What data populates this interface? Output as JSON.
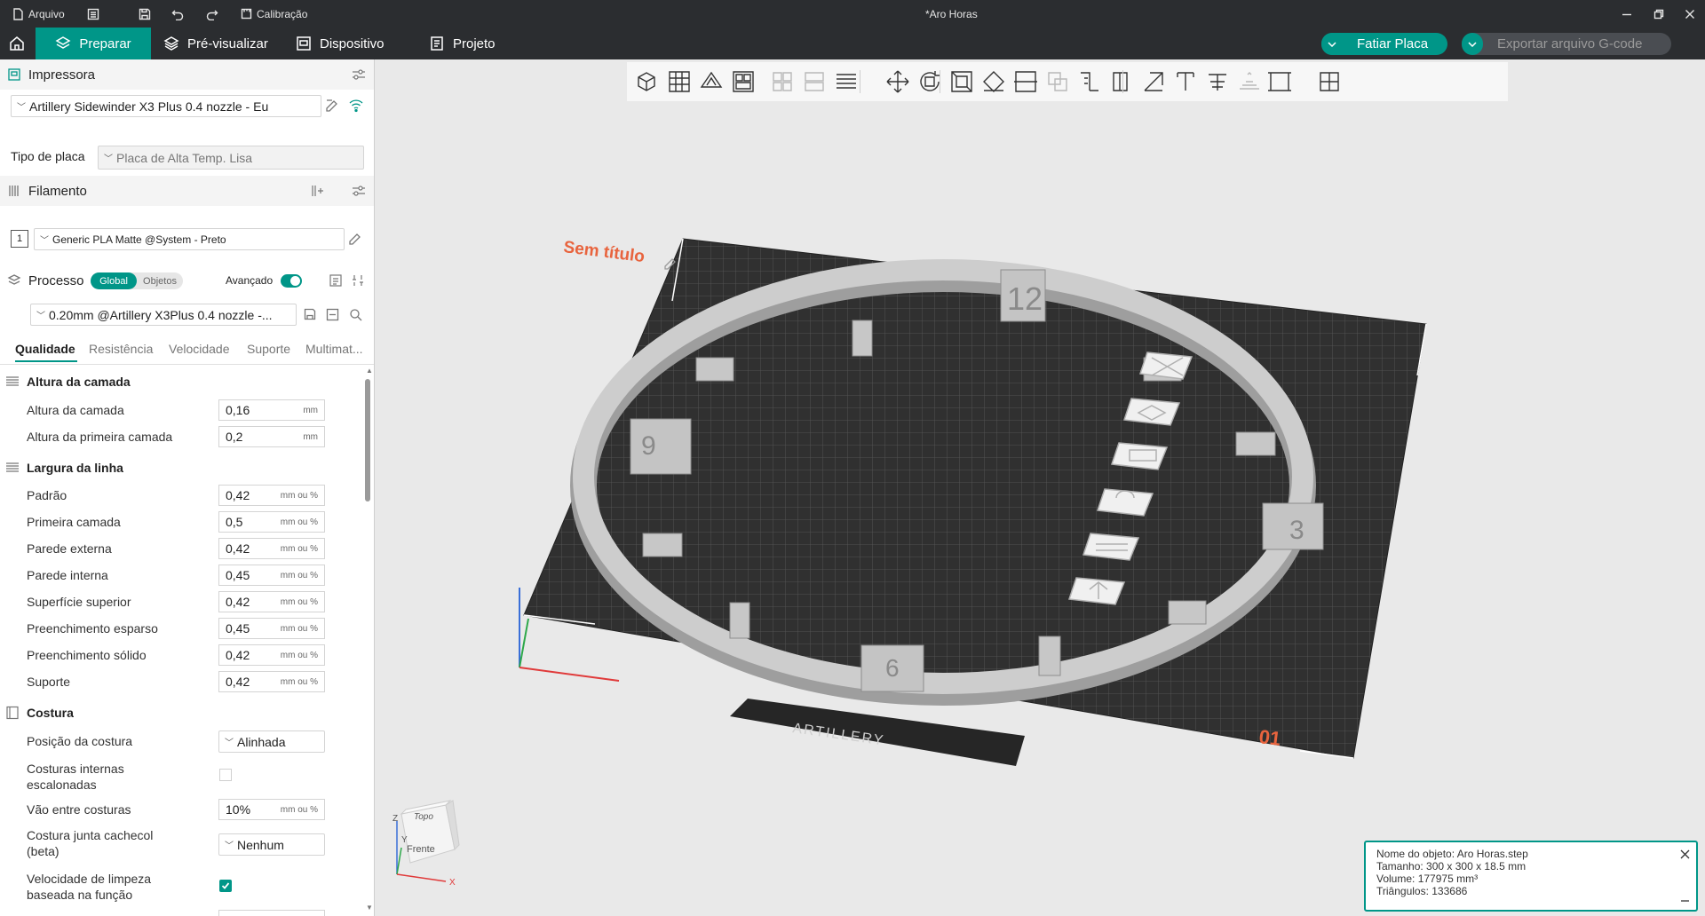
{
  "titlebar": {
    "file_label": "Arquivo",
    "calibration_label": "Calibração",
    "window_title": "*Aro Horas"
  },
  "menubar": {
    "tabs": [
      {
        "label": "Preparar",
        "active": true
      },
      {
        "label": "Pré-visualizar",
        "active": false
      },
      {
        "label": "Dispositivo",
        "active": false
      },
      {
        "label": "Projeto",
        "active": false
      }
    ],
    "slice_label": "Fatiar Placa",
    "export_label": "Exportar arquivo G-code",
    "accent_color": "#009688"
  },
  "printer": {
    "section_title": "Impressora",
    "selected_printer": "Artillery Sidewinder X3 Plus 0.4 nozzle - Eu",
    "plate_type_label": "Tipo de placa",
    "plate_type_value": "Placa de Alta Temp. Lisa"
  },
  "filament": {
    "section_title": "Filamento",
    "slot_number": "1",
    "selected_filament": "Generic PLA Matte @System - Preto"
  },
  "process": {
    "section_title": "Processo",
    "scope_global": "Global",
    "scope_objects": "Objetos",
    "advanced_label": "Avançado",
    "advanced_on": true,
    "profile": "0.20mm @Artillery X3Plus 0.4 nozzle -...",
    "tabs": [
      "Qualidade",
      "Resistência",
      "Velocidade",
      "Suporte",
      "Multimat..."
    ]
  },
  "settings": {
    "layer_height": {
      "title": "Altura da camada",
      "rows": [
        {
          "label": "Altura da camada",
          "value": "0,16",
          "unit": "mm"
        },
        {
          "label": "Altura da primeira camada",
          "value": "0,2",
          "unit": "mm"
        }
      ]
    },
    "line_width": {
      "title": "Largura da linha",
      "rows": [
        {
          "label": "Padrão",
          "value": "0,42",
          "unit": "mm ou %"
        },
        {
          "label": "Primeira camada",
          "value": "0,5",
          "unit": "mm ou %"
        },
        {
          "label": "Parede externa",
          "value": "0,42",
          "unit": "mm ou %"
        },
        {
          "label": "Parede interna",
          "value": "0,45",
          "unit": "mm ou %"
        },
        {
          "label": "Superfície superior",
          "value": "0,42",
          "unit": "mm ou %"
        },
        {
          "label": "Preenchimento esparso",
          "value": "0,45",
          "unit": "mm ou %"
        },
        {
          "label": "Preenchimento sólido",
          "value": "0,42",
          "unit": "mm ou %"
        },
        {
          "label": "Suporte",
          "value": "0,42",
          "unit": "mm ou %"
        }
      ]
    },
    "seam": {
      "title": "Costura",
      "position_label": "Posição da costura",
      "position_value": "Alinhada",
      "staggered_label_1": "Costuras internas",
      "staggered_label_2": "escalonadas",
      "staggered_checked": false,
      "gap_label": "Vão entre costuras",
      "gap_value": "10%",
      "gap_unit": "mm ou %",
      "scarf_label_1": "Costura junta cachecol",
      "scarf_label_2": "(beta)",
      "scarf_value": "Nenhum",
      "wipe_label_1": "Velocidade de limpeza",
      "wipe_label_2": "baseada na função",
      "wipe_checked": true
    }
  },
  "viewport": {
    "plate_name": "Sem título",
    "plate_number": "01",
    "brand_logo_text": "ARTILLERY",
    "clock_numbers": [
      "12",
      "3",
      "6",
      "9"
    ],
    "view_cube_top": "Topo",
    "view_cube_front": "Frente",
    "axis_x": "X",
    "axis_y": "Y",
    "axis_z": "Z"
  },
  "object_info": {
    "name": "Nome do objeto: Aro Horas.step",
    "size": "Tamanho: 300 x 300 x 18.5 mm",
    "volume": "Volume: 177975 mm³",
    "triangles": "Triângulos: 133686"
  }
}
